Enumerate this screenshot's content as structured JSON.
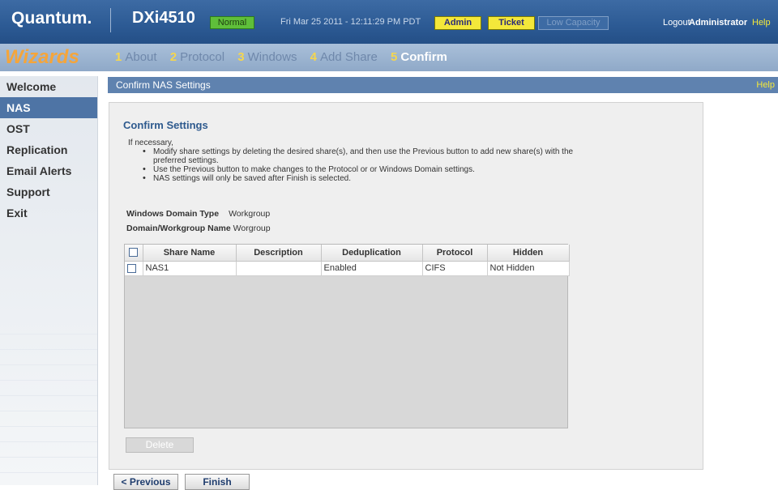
{
  "header": {
    "brand": "Quantum.",
    "model": "DXi4510",
    "status": "Normal",
    "datetime": "Fri Mar 25 2011 - 12:11:29 PM PDT",
    "admin_label": "Admin",
    "ticket_label": "Ticket",
    "low_capacity_label": "Low Capacity",
    "logout_label": "Logout",
    "user": "Administrator",
    "help_label": "Help"
  },
  "wizard": {
    "title": "Wizards",
    "steps": [
      {
        "num": "1",
        "label": "About"
      },
      {
        "num": "2",
        "label": "Protocol"
      },
      {
        "num": "3",
        "label": "Windows"
      },
      {
        "num": "4",
        "label": "Add Share"
      },
      {
        "num": "5",
        "label": "Confirm"
      }
    ],
    "active_step": 5
  },
  "sidebar": {
    "items": [
      {
        "label": "Welcome"
      },
      {
        "label": "NAS"
      },
      {
        "label": "OST"
      },
      {
        "label": "Replication"
      },
      {
        "label": "Email Alerts"
      },
      {
        "label": "Support"
      },
      {
        "label": "Exit"
      }
    ],
    "active": "NAS"
  },
  "panel": {
    "title": "Confirm NAS Settings",
    "help_label": "Help",
    "heading": "Confirm Settings",
    "intro": "If necessary,",
    "bullets": [
      "Modify share settings by deleting the desired share(s), and then use the Previous button to add new share(s) with the preferred settings.",
      "Use the Previous button to make changes to the Protocol or or Windows Domain settings.",
      "NAS settings will only be saved after Finish is selected."
    ],
    "domain_type_label": "Windows Domain Type",
    "domain_type_value": "Workgroup",
    "domain_name_label": "Domain/Workgroup Name",
    "domain_name_value": "Worgroup"
  },
  "table": {
    "columns": [
      "Share Name",
      "Description",
      "Deduplication",
      "Protocol",
      "Hidden"
    ],
    "rows": [
      {
        "share_name": "NAS1",
        "description": "",
        "deduplication": "Enabled",
        "protocol": "CIFS",
        "hidden": "Not Hidden"
      }
    ]
  },
  "buttons": {
    "delete": "Delete",
    "previous": "< Previous",
    "finish": "Finish"
  },
  "colors": {
    "header_bg": "#2c5a94",
    "status_green": "#5fbf3a",
    "badge_yellow": "#f4e83a",
    "wizard_orange": "#f5a53a",
    "step_number_yellow": "#f5d64e",
    "sidebar_active": "#4e74a5"
  }
}
